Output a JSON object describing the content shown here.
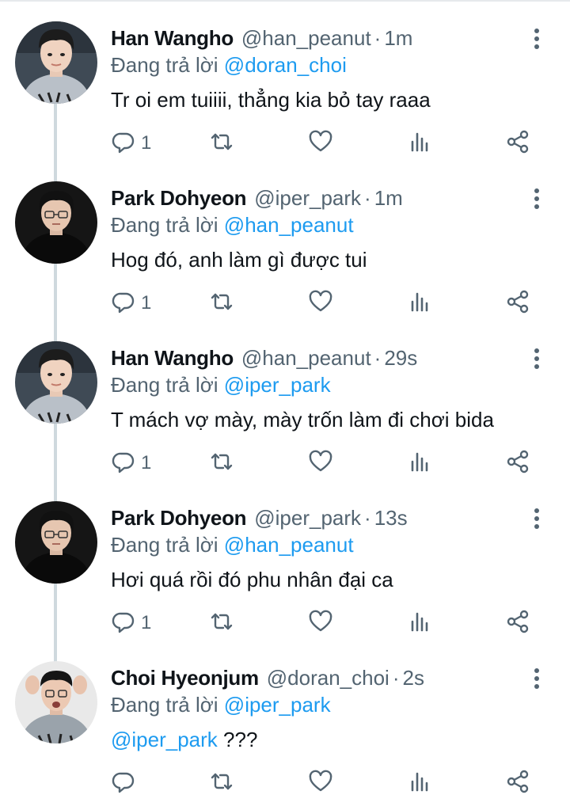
{
  "reply_prefix": "Đang trả lời",
  "tweets": [
    {
      "name": "Han Wangho",
      "handle": "@han_peanut",
      "dot": "·",
      "time": "1m",
      "reply_to": "@doran_choi",
      "text": "Tr oi em tuiiii, thẳng kia bỏ tay raaa",
      "mention_in_text": "",
      "reply_count": "1",
      "avatar": "han"
    },
    {
      "name": "Park Dohyeon",
      "handle": "@iper_park",
      "dot": "·",
      "time": "1m",
      "reply_to": "@han_peanut",
      "text": "Hog đó, anh làm gì được tui",
      "mention_in_text": "",
      "reply_count": "1",
      "avatar": "park"
    },
    {
      "name": "Han Wangho",
      "handle": "@han_peanut",
      "dot": "·",
      "time": "29s",
      "reply_to": "@iper_park",
      "text": "T mách vợ mày, mày trốn làm đi chơi bida",
      "mention_in_text": "",
      "reply_count": "1",
      "avatar": "han"
    },
    {
      "name": "Park Dohyeon",
      "handle": "@iper_park",
      "dot": "·",
      "time": "13s",
      "reply_to": "@han_peanut",
      "text": "Hơi quá rồi đó phu nhân đại ca",
      "mention_in_text": "",
      "reply_count": "1",
      "avatar": "park"
    },
    {
      "name": "Choi Hyeonjum",
      "handle": "@doran_choi",
      "dot": "·",
      "time": "2s",
      "reply_to": "@iper_park",
      "text": " ???",
      "mention_in_text": "@iper_park",
      "reply_count": "",
      "avatar": "choi"
    }
  ],
  "icons": [
    "reply-icon",
    "retweet-icon",
    "like-icon",
    "analytics-icon",
    "share-icon",
    "more-icon"
  ],
  "colors": {
    "mention": "#1d9bf0",
    "secondary": "#536471",
    "thread_line": "#cfd9de"
  }
}
